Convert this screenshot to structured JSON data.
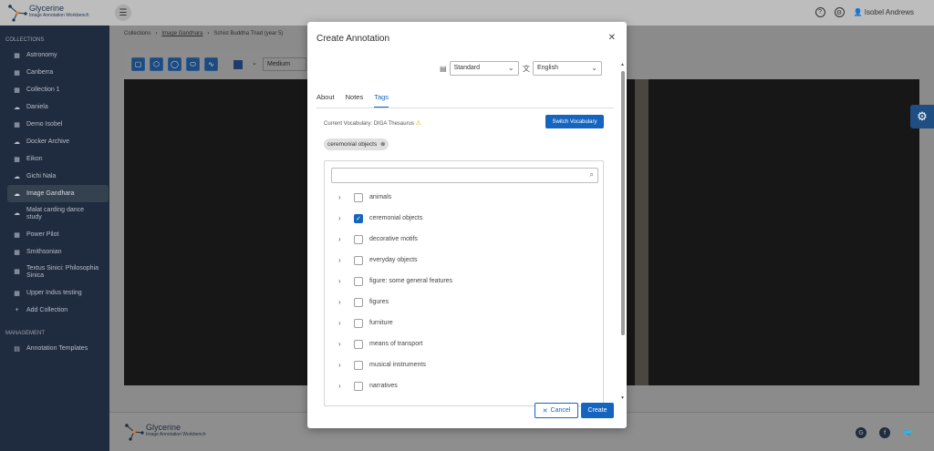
{
  "app": {
    "name": "Glycerine",
    "subtitle": "Image Annotation Workbench"
  },
  "header": {
    "user_name": "Isobel Andrews",
    "help_icon": "help-circle-icon",
    "settings_icon": "gear-icon",
    "user_icon": "user-icon"
  },
  "sidebar": {
    "collections_heading": "COLLECTIONS",
    "items": [
      {
        "label": "Astronomy",
        "icon": "grid"
      },
      {
        "label": "Canberra",
        "icon": "grid"
      },
      {
        "label": "Collection 1",
        "icon": "grid"
      },
      {
        "label": "Daniela",
        "icon": "cloud"
      },
      {
        "label": "Demo Isobel",
        "icon": "grid"
      },
      {
        "label": "Docker Archive",
        "icon": "cloud"
      },
      {
        "label": "Eikon",
        "icon": "grid"
      },
      {
        "label": "Gichi Nala",
        "icon": "cloud"
      },
      {
        "label": "Image Gandhara",
        "icon": "cloud"
      },
      {
        "label": "Malat carding dance study",
        "icon": "cloud"
      },
      {
        "label": "Power Pilot",
        "icon": "grid"
      },
      {
        "label": "Smithsonian",
        "icon": "grid"
      },
      {
        "label": "Textus Sinici: Philosophia Sinica",
        "icon": "grid"
      },
      {
        "label": "Upper Indus testing",
        "icon": "grid"
      }
    ],
    "add_collection": "Add Collection",
    "management_heading": "MANAGEMENT",
    "annotation_templates": "Annotation Templates"
  },
  "breadcrumb": {
    "root": "Collections",
    "collection": "Image Gandhara",
    "item": "Schist Buddha Triad (year 5)"
  },
  "toolbar": {
    "stroke": "Medium"
  },
  "modal": {
    "title": "Create Annotation",
    "template_select": "Standard",
    "language_select": "English",
    "tabs": [
      "About",
      "Notes",
      "Tags"
    ],
    "active_tab": "Tags",
    "vocab_label": "Current Vocabulary: DIGA Thesaurus",
    "switch_vocab": "Switch Vocabulary",
    "selected_tag": "ceremonial objects",
    "tree_items": [
      {
        "label": "animals",
        "checked": false
      },
      {
        "label": "ceremonial objects",
        "checked": true
      },
      {
        "label": "decorative motifs",
        "checked": false
      },
      {
        "label": "everyday objects",
        "checked": false
      },
      {
        "label": "figure: some general features",
        "checked": false
      },
      {
        "label": "figures",
        "checked": false
      },
      {
        "label": "furniture",
        "checked": false
      },
      {
        "label": "means of transport",
        "checked": false
      },
      {
        "label": "musical instruments",
        "checked": false
      },
      {
        "label": "narratives",
        "checked": false
      }
    ],
    "cancel": "Cancel",
    "create": "Create"
  },
  "footer": {
    "name": "Glycerine",
    "subtitle": "Image Annotation Workbench"
  },
  "colors": {
    "accent": "#1565c0",
    "sidebar": "#1f2b3e"
  }
}
